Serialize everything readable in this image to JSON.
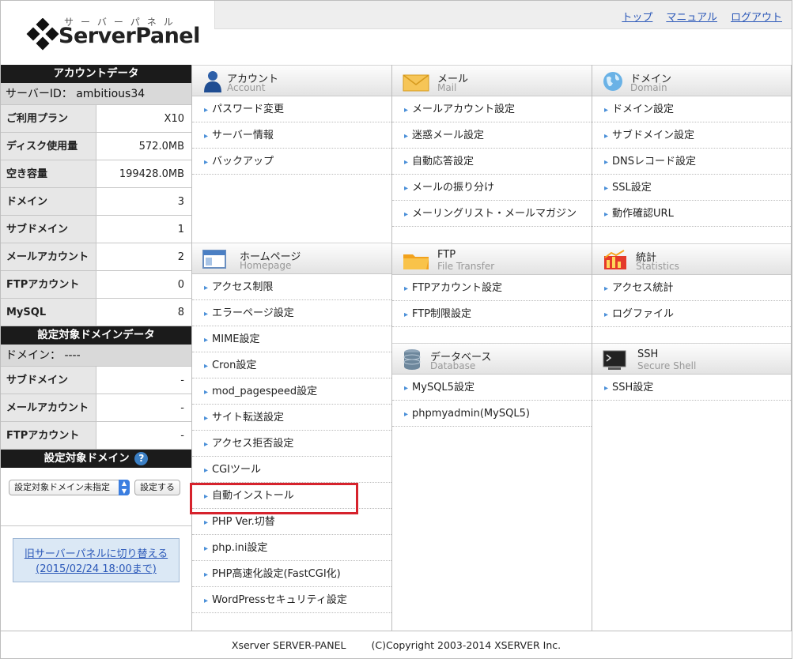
{
  "header": {
    "logo_kana": "サーバーパネル",
    "logo_name": "ServerPanel",
    "links": [
      "トップ",
      "マニュアル",
      "ログアウト"
    ]
  },
  "account": {
    "title": "アカウントデータ",
    "server_id": "サーバーID： ambitious34",
    "rows": [
      {
        "label": "ご利用プラン",
        "value": "X10"
      },
      {
        "label": "ディスク使用量",
        "value": "572.0MB"
      },
      {
        "label": "空き容量",
        "value": "199428.0MB"
      },
      {
        "label": "ドメイン",
        "value": "3"
      },
      {
        "label": "サブドメイン",
        "value": "1"
      },
      {
        "label": "メールアカウント",
        "value": "2"
      },
      {
        "label": "FTPアカウント",
        "value": "0"
      },
      {
        "label": "MySQL",
        "value": "8"
      }
    ]
  },
  "domain_data": {
    "title": "設定対象ドメインデータ",
    "domain": "ドメイン： ----",
    "rows": [
      {
        "label": "サブドメイン",
        "value": "-"
      },
      {
        "label": "メールアカウント",
        "value": "-"
      },
      {
        "label": "FTPアカウント",
        "value": "-"
      }
    ]
  },
  "domain_select": {
    "title": "設定対象ドメイン",
    "help": "?",
    "selected": "設定対象ドメイン未指定",
    "submit": "設定する"
  },
  "old_panel": {
    "line1": "旧サーバーパネルに切り替える",
    "line2": "(2015/02/24 18:00まで)"
  },
  "sections": {
    "account": {
      "jp": "アカウント",
      "en": "Account",
      "items": [
        "パスワード変更",
        "サーバー情報",
        "バックアップ"
      ]
    },
    "mail": {
      "jp": "メール",
      "en": "Mail",
      "items": [
        "メールアカウント設定",
        "迷惑メール設定",
        "自動応答設定",
        "メールの振り分け",
        "メーリングリスト・メールマガジン"
      ]
    },
    "domain": {
      "jp": "ドメイン",
      "en": "Domain",
      "items": [
        "ドメイン設定",
        "サブドメイン設定",
        "DNSレコード設定",
        "SSL設定",
        "動作確認URL"
      ]
    },
    "homepage": {
      "jp": "ホームページ",
      "en": "Homepage",
      "items": [
        "アクセス制限",
        "エラーページ設定",
        "MIME設定",
        "Cron設定",
        "mod_pagespeed設定",
        "サイト転送設定",
        "アクセス拒否設定",
        "CGIツール",
        "自動インストール",
        "PHP Ver.切替",
        "php.ini設定",
        "PHP高速化設定(FastCGI化)",
        "WordPressセキュリティ設定"
      ]
    },
    "ftp": {
      "jp": "FTP",
      "en": "File Transfer",
      "items": [
        "FTPアカウント設定",
        "FTP制限設定"
      ]
    },
    "stats": {
      "jp": "統計",
      "en": "Statistics",
      "items": [
        "アクセス統計",
        "ログファイル"
      ]
    },
    "database": {
      "jp": "データベース",
      "en": "Database",
      "items": [
        "MySQL5設定",
        "phpmyadmin(MySQL5)"
      ]
    },
    "ssh": {
      "jp": "SSH",
      "en": "Secure Shell",
      "items": [
        "SSH設定"
      ]
    }
  },
  "footer": {
    "left": "Xserver SERVER-PANEL",
    "right": "(C)Copyright 2003-2014 XSERVER Inc."
  },
  "colors": {
    "accent_link": "#2a57b8",
    "highlight": "#d6222c",
    "header_dark": "#1b1b1b"
  }
}
